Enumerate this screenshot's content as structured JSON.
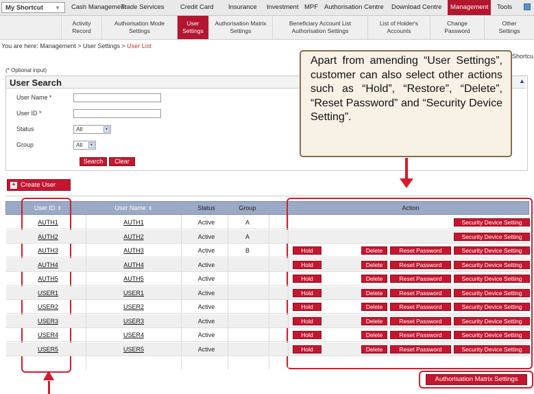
{
  "topnav": {
    "shortcut_label": "My Shortcut",
    "items": [
      "Cash Management",
      "Trade Services",
      "Credit Card",
      "Insurance",
      "Investment",
      "MPF",
      "Authorisation Centre",
      "Download Centre",
      "Management",
      "Tools"
    ],
    "active": "Management"
  },
  "subnav": {
    "items": [
      [
        "Activity",
        "Record"
      ],
      [
        "Authorisation Mode",
        "Settings"
      ],
      [
        "User",
        "Settings"
      ],
      [
        "Authorisation Matrix",
        "Settings"
      ],
      [
        "Beneficiary Account List",
        "Authorisation Settings"
      ],
      [
        "List of Holder's",
        "Accounts"
      ],
      [
        "Change",
        "Password"
      ],
      [
        "Other",
        "Settings"
      ]
    ],
    "active": "User Settings"
  },
  "breadcrumb": {
    "prefix": "You are here: Management > User Settings > ",
    "current": "User List"
  },
  "shortcut_right": "Shortcu",
  "optional_note": "(* Optional input)",
  "search": {
    "title": "User Search",
    "user_name_label": "User Name *",
    "user_id_label": "User ID *",
    "status_label": "Status",
    "status_value": "All",
    "group_label": "Group",
    "group_value": "All",
    "search_button": "Search",
    "clear_button": "Clear"
  },
  "create_user_button": "Create User",
  "table": {
    "headers": [
      "User ID",
      "User Name",
      "Status",
      "Group",
      "Action"
    ],
    "rows": [
      {
        "id": "AUTH1",
        "name": "AUTH1",
        "status": "Active",
        "group": "A",
        "hold": false
      },
      {
        "id": "AUTH2",
        "name": "AUTH2",
        "status": "Active",
        "group": "A",
        "hold": false
      },
      {
        "id": "AUTH3",
        "name": "AUTH3",
        "status": "Active",
        "group": "B",
        "hold": true
      },
      {
        "id": "AUTH4",
        "name": "AUTH4",
        "status": "Active",
        "group": "",
        "hold": true
      },
      {
        "id": "AUTH5",
        "name": "AUTH5",
        "status": "Active",
        "group": "",
        "hold": true
      },
      {
        "id": "USER1",
        "name": "USER1",
        "status": "Active",
        "group": "",
        "hold": true
      },
      {
        "id": "USER2",
        "name": "USER2",
        "status": "Active",
        "group": "",
        "hold": true
      },
      {
        "id": "USER3",
        "name": "USER3",
        "status": "Active",
        "group": "",
        "hold": true
      },
      {
        "id": "USER4",
        "name": "USER4",
        "status": "Active",
        "group": "",
        "hold": true
      },
      {
        "id": "USER5",
        "name": "USER5",
        "status": "Active",
        "group": "",
        "hold": true
      }
    ],
    "action_labels": {
      "hold": "Hold",
      "delete": "Delete",
      "reset_password": "Reset Password",
      "security_device": "Security Device Setting"
    }
  },
  "callout_text": "Apart from amending “User Settings”, customer can also select other actions such as “Hold”, “Restore”, “Delete”, “Reset Password” and “Security Device Setting”.",
  "auth_matrix_button": "Authorisation Matrix Settings",
  "colors": {
    "brand_red": "#c4172f",
    "header_blue": "#9aa9c5",
    "highlight_red": "#d7192c",
    "callout_bg": "#f7f1e6"
  }
}
